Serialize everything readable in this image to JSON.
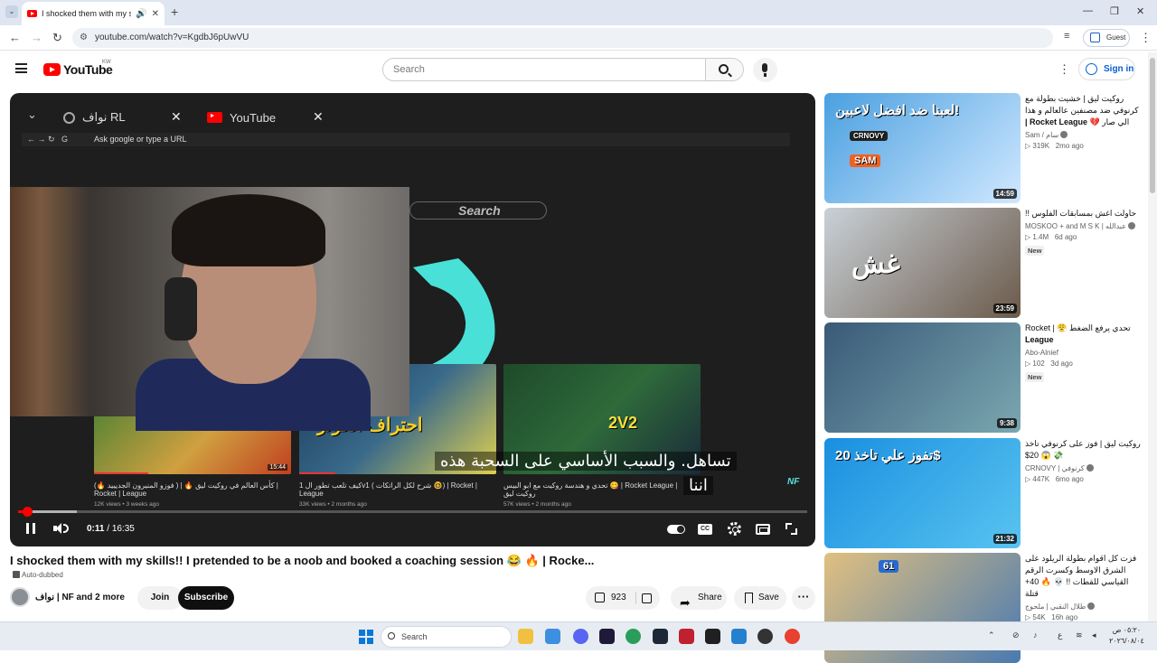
{
  "browser": {
    "tab_title": "I shocked them with my ski",
    "url": "youtube.com/watch?v=KgdbJ6pUwVU",
    "guest_label": "Guest"
  },
  "youtube": {
    "logo_text": "YouTube",
    "country": "KW",
    "search_placeholder": "Search",
    "signin_label": "Sign in"
  },
  "player": {
    "inner_tabs": [
      "نواف RL",
      "YouTube"
    ],
    "inner_address": "Ask google or type a URL",
    "inner_search": "Search",
    "inner_videos": [
      {
        "title": "كأس العالم في روكيت ليق 🔥 | ( فوزو المنيرون الجديييد 🔥) | Rocket | League",
        "meta": "12K views • 3 weeks ago",
        "duration": "15:44"
      },
      {
        "title": "كيف تلعب تطور ال 1v1 ( شرح لكل الراتكات 🤓) | Rocket | League",
        "meta": "33K views • 2 months ago",
        "duration": ""
      },
      {
        "title": "تحدي و هندسة روكيت مع ابو البيس 😋 | Rocket League | روكيت ليق",
        "meta": "57K views • 2 months ago",
        "duration": ""
      }
    ],
    "thumb_texts": [
      "احتراف الكونز",
      "2V2"
    ],
    "subtitle_line1": "تساهل. والسبب الأساسي على السحبة هذه",
    "subtitle_line2": "اننا",
    "watermark": "NF",
    "time_current": "0:11",
    "time_total": "16:35",
    "progress_fraction": 0.011,
    "buffered_fraction": 0.075,
    "cc_label": "CC"
  },
  "video": {
    "title": "I shocked them with my skills!! I pretended to be a noob and booked a coaching session 😂 🔥 | Rocke...",
    "auto_dubbed": "Auto-dubbed",
    "channel": "نواف | NF and 2 more",
    "join": "Join",
    "subscribe": "Subscribe",
    "likes": "923",
    "share": "Share",
    "save": "Save"
  },
  "recommendations": [
    {
      "title_ar": "روكيت ليق | خشيت بطولة مع كرنوفي ضد مصنفين عالعالم و هذا الي صار 💔",
      "title_en": "Rocket League |",
      "channel": "Sam / سام",
      "verified": true,
      "views": "319K",
      "age": "2mo ago",
      "is_new": false,
      "duration": "14:59",
      "thumb_text": "لعبنا ضد افضل لاعبين!",
      "thumb_label": "SAM",
      "thumb_label2": "CRNOVY",
      "colors": [
        "#4aa0e0",
        "#d0e8ff"
      ]
    },
    {
      "title_ar": "حاولت اغش بمسابقات الفلوس !!",
      "title_en": "",
      "channel": "MOSKOO + and M S K | عبدالله",
      "verified": true,
      "views": "1.4M",
      "age": "6d ago",
      "is_new": true,
      "duration": "23:59",
      "thumb_text": "غش",
      "thumb_label": "",
      "thumb_label2": "",
      "colors": [
        "#c9d1d8",
        "#6b5a4a"
      ]
    },
    {
      "title_ar": "تحدي يرفع الضغط 😤 | Rocket",
      "title_en": "League",
      "channel": "Abo-Alnief",
      "verified": false,
      "views": "102",
      "age": "3d ago",
      "is_new": true,
      "duration": "9:38",
      "thumb_text": "",
      "thumb_label": "",
      "thumb_label2": "",
      "colors": [
        "#3a5a78",
        "#7aa7b0"
      ]
    },
    {
      "title_ar": "روكيت ليق | فوز على كرنوفي تاخذ 💸 😱 20$",
      "title_en": "",
      "channel": "CRNOVY | كرنوفي",
      "verified": true,
      "views": "447K",
      "age": "6mo ago",
      "is_new": false,
      "duration": "21:32",
      "thumb_text": "تفوز علي تاخذ 20$",
      "thumb_label": "",
      "thumb_label2": "",
      "colors": [
        "#1a8fe0",
        "#58c4f0"
      ]
    },
    {
      "title_ar": "فزت كل اقوام بطولة الريلود على الشرق الاوسط وكسرت الرقم القياسي للقطات !! 💀 🔥 40+ قتلة",
      "title_en": "",
      "channel": "طلال النقبي | ملحوج",
      "verified": true,
      "views": "54K",
      "age": "16h ago",
      "is_new": true,
      "duration": "",
      "thumb_text": "",
      "thumb_label": "61",
      "thumb_label2": "",
      "colors": [
        "#e0c080",
        "#4a7ab0"
      ]
    }
  ],
  "taskbar": {
    "search_label": "Search",
    "time": "٠٥:٢٠ ص",
    "date": "٢٠٢٦/٠٨/٠٤",
    "lang": "ع"
  },
  "icons": [
    "search-icon",
    "mic-icon",
    "menu-icon",
    "bell-icon",
    "like-icon",
    "dislike-icon",
    "share-icon",
    "save-icon",
    "more-icon",
    "gear-icon",
    "cc-icon",
    "fullscreen-icon",
    "pause-icon",
    "volume-icon"
  ]
}
